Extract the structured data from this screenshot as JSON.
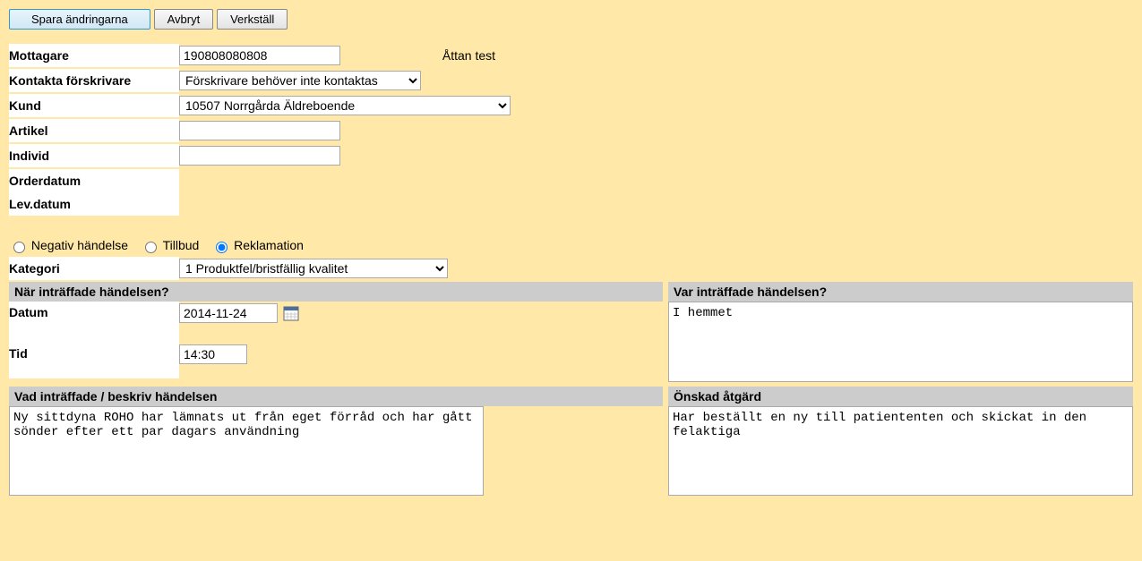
{
  "toolbar": {
    "save": "Spara ändringarna",
    "cancel": "Avbryt",
    "apply": "Verkställ"
  },
  "labels": {
    "mottagare": "Mottagare",
    "kontakta": "Kontakta förskrivare",
    "kund": "Kund",
    "artikel": "Artikel",
    "individ": "Individ",
    "orderdatum": "Orderdatum",
    "levdatum": "Lev.datum",
    "kategori": "Kategori",
    "datum": "Datum",
    "tid": "Tid"
  },
  "values": {
    "mottagare": "190808080808",
    "mottagare_name": "Åttan test",
    "kontakta": "Förskrivare behöver inte kontaktas",
    "kund": "10507 Norrgårda Äldreboende",
    "artikel": "",
    "individ": "",
    "orderdatum": "",
    "levdatum": "",
    "kategori": "1 Produktfel/bristfällig kvalitet",
    "datum": "2014-11-24",
    "tid": "14:30",
    "var_intraffade": "I hemmet",
    "vad_intraffade": "Ny sittdyna ROHO har lämnats ut från eget förråd och har gått sönder efter ett par dagars användning",
    "onskad_atgard": "Har beställt en ny till patiententen och skickat in den felaktiga"
  },
  "radios": {
    "negativ": "Negativ händelse",
    "tillbud": "Tillbud",
    "reklamation": "Reklamation",
    "selected": "reklamation"
  },
  "sections": {
    "nar": "När inträffade händelsen?",
    "var": "Var inträffade händelsen?",
    "vad": "Vad inträffade / beskriv händelsen",
    "atgard": "Önskad åtgärd"
  }
}
